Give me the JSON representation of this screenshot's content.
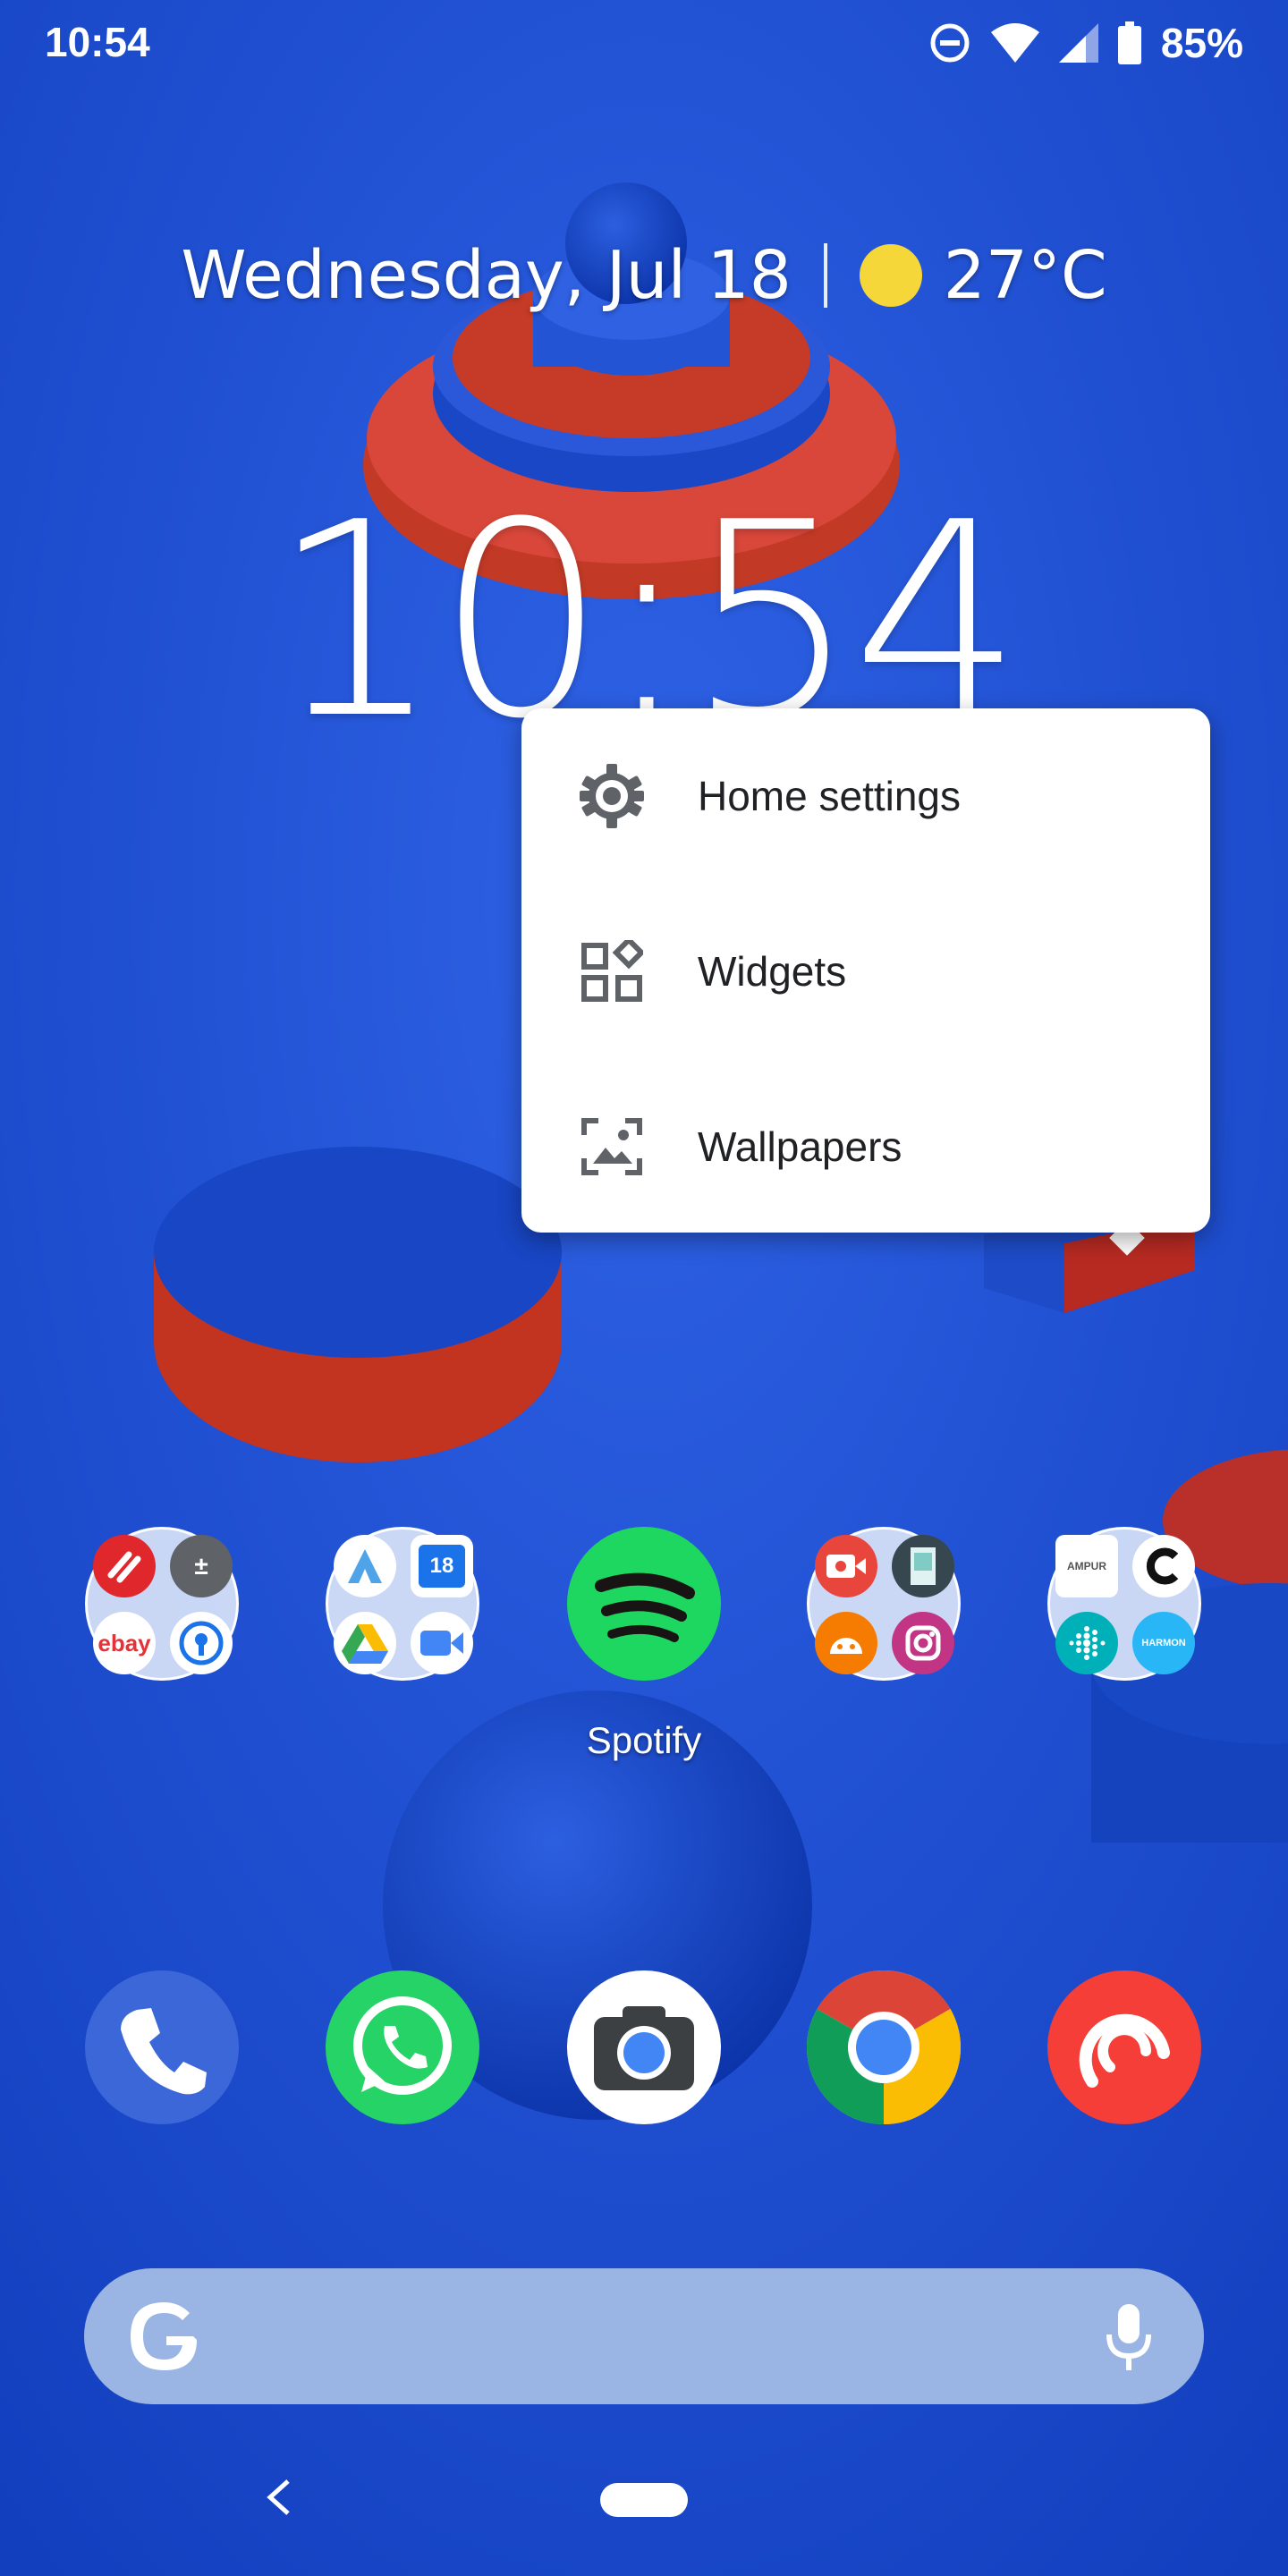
{
  "status_bar": {
    "time": "10:54",
    "battery_percent": "85%",
    "icons": [
      "dnd-icon",
      "wifi-icon",
      "signal-icon",
      "battery-icon"
    ]
  },
  "glance": {
    "date": "Wednesday, Jul 18",
    "weather_icon": "sun-icon",
    "temperature": "27°C"
  },
  "clock": {
    "time": "10:54"
  },
  "menu": {
    "items": [
      {
        "label": "Home settings",
        "icon": "gear-icon"
      },
      {
        "label": "Widgets",
        "icon": "widgets-icon"
      },
      {
        "label": "Wallpapers",
        "icon": "wallpaper-icon"
      }
    ]
  },
  "apps": {
    "spotify_label": "Spotify",
    "folder1": [
      "authy-icon",
      "calculator-icon",
      "ebay-icon",
      "password-manager-icon"
    ],
    "folder1_text": {
      "ebay": "ebay"
    },
    "folder2": [
      "arc-icon",
      "calendar-icon",
      "drive-icon",
      "meet-icon"
    ],
    "folder2_text": {
      "calendar": "18"
    },
    "folder4": [
      "screen-recorder-icon",
      "app-icon",
      "android-icon",
      "instagram-icon"
    ],
    "folder5": [
      "ampup-icon",
      "c-app-icon",
      "fitbit-icon",
      "harmony-icon"
    ],
    "folder5_text": {
      "ampup": "AMPUR",
      "harmony": "HARMON"
    }
  },
  "dock": [
    "phone-icon",
    "whatsapp-icon",
    "camera-icon",
    "chrome-icon",
    "pocket-casts-icon"
  ],
  "colors": {
    "wallpaper_blue": "#1f52d6",
    "accent_red": "#d63a2a",
    "search_bar": "#9ab5e3"
  }
}
